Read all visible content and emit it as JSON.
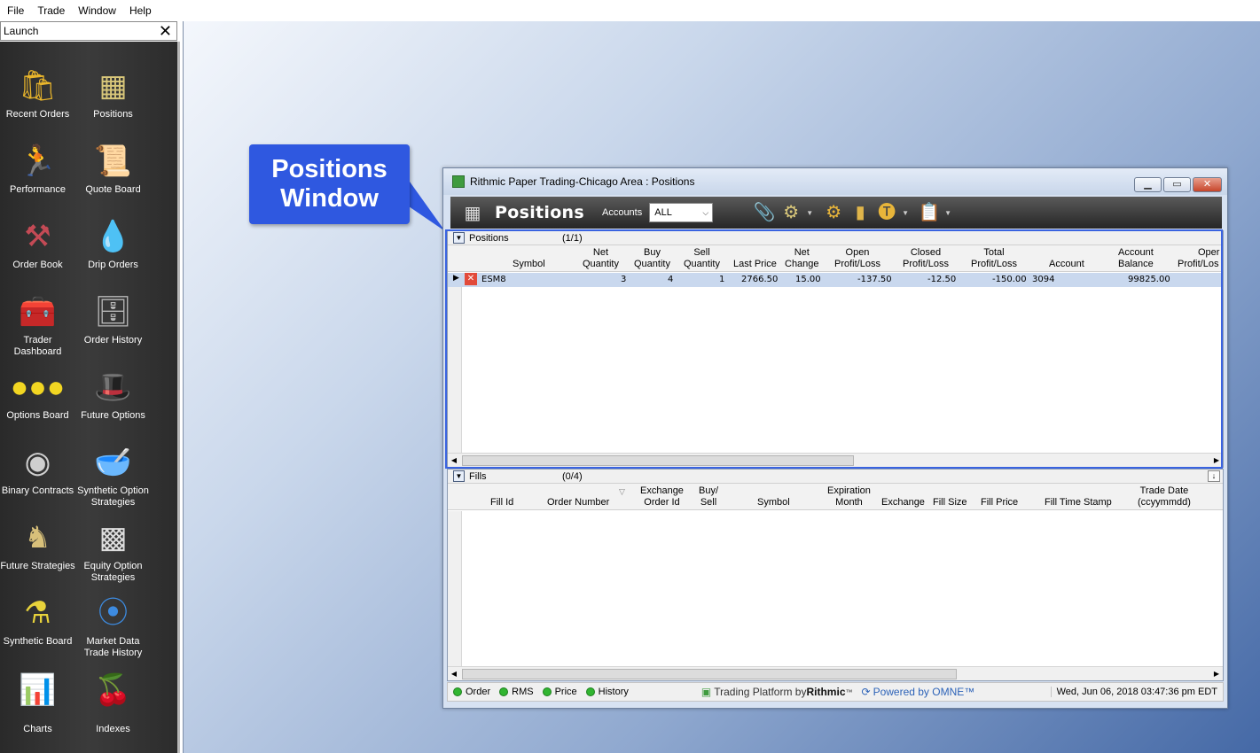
{
  "menu": [
    "File",
    "Trade",
    "Window",
    "Help"
  ],
  "launch": {
    "title": "Launch",
    "close_glyph": "✕",
    "items": [
      {
        "label": "Recent Orders",
        "icon": "recent-orders-icon"
      },
      {
        "label": "Positions",
        "icon": "positions-icon"
      },
      {
        "label": "Performance",
        "icon": "performance-icon"
      },
      {
        "label": "Quote Board",
        "icon": "quote-board-icon"
      },
      {
        "label": "Order Book",
        "icon": "order-book-icon"
      },
      {
        "label": "Drip Orders",
        "icon": "drip-orders-icon"
      },
      {
        "label": "Trader Dashboard",
        "icon": "trader-dashboard-icon"
      },
      {
        "label": "Order History",
        "icon": "order-history-icon"
      },
      {
        "label": "Options Board",
        "icon": "options-board-icon"
      },
      {
        "label": "Future Options",
        "icon": "future-options-icon"
      },
      {
        "label": "Binary Contracts",
        "icon": "binary-contracts-icon"
      },
      {
        "label": "Synthetic Option Strategies",
        "icon": "synthetic-option-strategies-icon"
      },
      {
        "label": "Future Strategies",
        "icon": "future-strategies-icon"
      },
      {
        "label": "Equity Option Strategies",
        "icon": "equity-option-strategies-icon"
      },
      {
        "label": "Synthetic Board",
        "icon": "synthetic-board-icon"
      },
      {
        "label": "Market Data Trade History",
        "icon": "market-data-trade-history-icon"
      },
      {
        "label": "Charts",
        "icon": "charts-icon"
      },
      {
        "label": "Indexes",
        "icon": "indexes-icon"
      }
    ]
  },
  "callout": {
    "line1": "Positions",
    "line2": "Window"
  },
  "window": {
    "title": "Rithmic Paper Trading-Chicago Area : Positions",
    "toolbar": {
      "title": "Positions",
      "accounts_label": "Accounts",
      "accounts_value": "ALL"
    }
  },
  "positions": {
    "caption": "Positions",
    "count": "(1/1)",
    "columns": {
      "symbol": "Symbol",
      "net_qty": [
        "Net",
        "Quantity"
      ],
      "buy_qty": [
        "Buy",
        "Quantity"
      ],
      "sell_qty": [
        "Sell",
        "Quantity"
      ],
      "last_price": "Last Price",
      "net_change": [
        "Net",
        "Change"
      ],
      "open_pl": [
        "Open",
        "Profit/Loss"
      ],
      "closed_pl": [
        "Closed",
        "Profit/Loss"
      ],
      "total_pl": [
        "Total",
        "Profit/Loss"
      ],
      "account": "Account",
      "account_balance": [
        "Account",
        "Balance"
      ],
      "open_cut": [
        "Oper",
        "Profit/Los"
      ]
    },
    "rows": [
      {
        "symbol": "ESM8",
        "net_qty": "3",
        "buy_qty": "4",
        "sell_qty": "1",
        "last_price": "2766.50",
        "net_change": "15.00",
        "open_pl": "-137.50",
        "closed_pl": "-12.50",
        "total_pl": "-150.00",
        "account": "3094",
        "account_balance": "99825.00"
      }
    ]
  },
  "fills": {
    "caption": "Fills",
    "count": "(0/4)",
    "columns": {
      "fill_id": "Fill Id",
      "order_number": "Order Number",
      "exchange_order_id": [
        "Exchange",
        "Order Id"
      ],
      "buy_sell": [
        "Buy/",
        "Sell"
      ],
      "symbol": "Symbol",
      "expiration": [
        "Expiration",
        "Month"
      ],
      "exchange": "Exchange",
      "fill_size": "Fill Size",
      "fill_price": "Fill Price",
      "fill_time": "Fill Time Stamp",
      "trade_date": [
        "Trade Date",
        "(ccyymmdd)"
      ]
    }
  },
  "status": {
    "items": [
      "Order",
      "RMS",
      "Price",
      "History"
    ],
    "platform_prefix": "Trading Platform by ",
    "platform_brand": "Rithmic",
    "powered": "Powered by OMNE™",
    "datetime": "Wed, Jun 06, 2018 03:47:36 pm EDT"
  }
}
